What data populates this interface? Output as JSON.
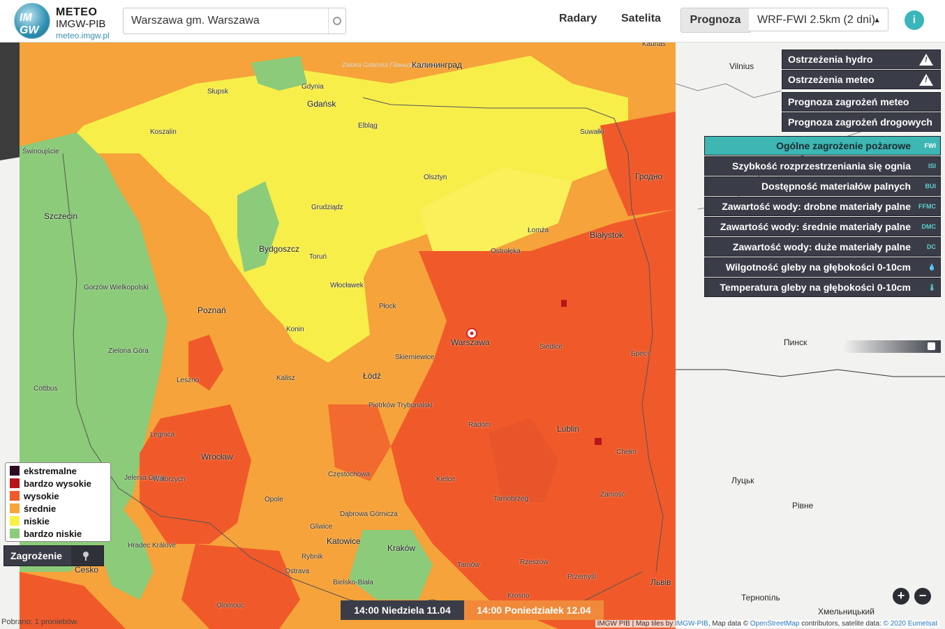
{
  "header": {
    "logo_line1": "METEO",
    "logo_line2": "IMGW-PIB",
    "logo_url": "meteo.imgw.pl",
    "logo_badge": "IM GW",
    "search_value": "Warszawa gm. Warszawa",
    "nav": {
      "radar": "Radary",
      "satellite": "Satelita"
    },
    "prognoza": "Prognoza",
    "model_select": "WRF-FWI 2.5km (2 dni)",
    "info_glyph": "i"
  },
  "right_panel": {
    "warnings": [
      {
        "label": "Ostrzeżenia hydro",
        "icon": "warning-icon"
      },
      {
        "label": "Ostrzeżenia meteo",
        "icon": "warning-icon"
      },
      {
        "label": "Prognoza zagrożeń meteo"
      },
      {
        "label": "Prognoza zagrożeń drogowych"
      }
    ],
    "layers": [
      {
        "label": "Ogólne zagrożenie pożarowe",
        "abbr": "FWI",
        "active": true
      },
      {
        "label": "Szybkość rozprzestrzeniania się ognia",
        "abbr": "ISI"
      },
      {
        "label": "Dostępność materiałów palnych",
        "abbr": "BUI"
      },
      {
        "label": "Zawartość wody: drobne materiały palne",
        "abbr": "FFMC"
      },
      {
        "label": "Zawartość wody: średnie materiały palne",
        "abbr": "DMC"
      },
      {
        "label": "Zawartość wody: duże materiały palne",
        "abbr": "DC"
      },
      {
        "label": "Wilgotność gleby na głębokości 0-10cm",
        "abbr": "💧"
      },
      {
        "label": "Temperatura gleby na głębokości 0-10cm",
        "abbr": "🌡"
      }
    ]
  },
  "legend": {
    "items": [
      {
        "label": "ekstremalne",
        "color": "#2b0a22"
      },
      {
        "label": "bardzo wysokie",
        "color": "#b8141c"
      },
      {
        "label": "wysokie",
        "color": "#f05a2a"
      },
      {
        "label": "średnie",
        "color": "#f7a53a"
      },
      {
        "label": "niskie",
        "color": "#f7f049"
      },
      {
        "label": "bardzo niskie",
        "color": "#8ccb7a"
      }
    ],
    "toggle_label": "Zagrożenie"
  },
  "timebar": {
    "current": "14:00 Niedziela 11.04",
    "next": "14:00 Poniedziałek 12.04"
  },
  "zoom": {
    "in": "+",
    "out": "−"
  },
  "status": "Pobrano: 1 proniebów.",
  "attribution": {
    "prefix": "IMGW PIB | Map tiles by ",
    "imgw": "IMGW-PIB",
    "mid": ", Map data © ",
    "osm": "OpenStreetMap",
    "mid2": " contributors, satelite data: ",
    "eum": "© 2020 Eumetsat"
  },
  "map": {
    "sea_label": "Zatoka Gdańska Гданьская бухта",
    "selected_city": "Warszawa",
    "cities": [
      "Gdańsk",
      "Gdynia",
      "Słupsk",
      "Koszalin",
      "Świnoujście",
      "Szczecin",
      "Elbląg",
      "Kaliningrad",
      "Калининград",
      "Olsztyn",
      "Grudziądz",
      "Bydgoszcz",
      "Toruń",
      "Włocławek",
      "Płock",
      "Gorzów Wielkopolski",
      "Poznań",
      "Konin",
      "Zielona Góra",
      "Cottbus",
      "Leszno",
      "Kalisz",
      "Łódź",
      "Skierniewice",
      "Piotrków Trybunalski",
      "Legnica",
      "Wrocław",
      "Jelenia Góra",
      "Wałbrzych",
      "Opole",
      "Częstochowa",
      "Kielce",
      "Radom",
      "Lublin",
      "Chełm",
      "Zamość",
      "Tarnobrzeg",
      "Dąbrowa Górnicza",
      "Gliwice",
      "Katowice",
      "Rybnik",
      "Kraków",
      "Ostrava",
      "Bielsko-Biała",
      "Tarnów",
      "Rzeszów",
      "Przemyśl",
      "Krosno",
      "Olomouc",
      "Hradec Králové",
      "Česko",
      "Siedlce",
      "Ostrołęka",
      "Łomża",
      "Białystok",
      "Suwałki",
      "Kaunas",
      "Vilnius",
      "Гродно",
      "Брест",
      "Пинск",
      "Луцьк",
      "Рівне",
      "Львів",
      "Тернопіль",
      "Хмельницький"
    ],
    "city_warszawa": "Warszawa",
    "city_gdansk": "Gdańsk",
    "city_kaunas": "Kaunas",
    "city_vilnius": "Vilnius",
    "city_kaliningrad": "Калининград",
    "city_olsztyn": "Olsztyn",
    "city_bydgoszcz": "Bydgoszcz",
    "city_poznan": "Poznań",
    "city_szczecin": "Szczecin",
    "city_lodz": "Łódź",
    "city_wroclaw": "Wrocław",
    "city_krakow": "Kraków",
    "city_lublin": "Lublin",
    "city_bialystok": "Białystok",
    "city_grodno": "Гродно",
    "city_brest": "Брест",
    "city_pinsk": "Пинск",
    "city_lutsk": "Луцьк",
    "city_rivne": "Рівне",
    "city_lviv": "Львів",
    "city_ternopil": "Тернопіль",
    "city_khm": "Хмельницький",
    "city_koszalin": "Koszalin",
    "city_slupsk": "Słupsk",
    "city_gdynia": "Gdynia",
    "city_elblag": "Elbląg",
    "city_swin": "Świnoujście",
    "city_grudziadz": "Grudziądz",
    "city_torun": "Toruń",
    "city_wloclawek": "Włocławek",
    "city_plock": "Płock",
    "city_gorzow": "Gorzów Wielkopolski",
    "city_konin": "Konin",
    "city_zielona": "Zielona Góra",
    "city_cottbus": "Cottbus",
    "city_leszno": "Leszno",
    "city_kalisz": "Kalisz",
    "city_skier": "Skierniewice",
    "city_piotrkow": "Piotrków Trybunalski",
    "city_legnica": "Legnica",
    "city_jelenia": "Jelenia Góra",
    "city_walbrzych": "Wałbrzych",
    "city_opole": "Opole",
    "city_czest": "Częstochowa",
    "city_kielce": "Kielce",
    "city_radom": "Radom",
    "city_chelm": "Chełm",
    "city_zamosc": "Zamość",
    "city_tarnobrzeg": "Tarnobrzeg",
    "city_dabrowa": "Dąbrowa Górnicza",
    "city_gliwice": "Gliwice",
    "city_katowice": "Katowice",
    "city_rybnik": "Rybnik",
    "city_ostrava": "Ostrava",
    "city_bielsko": "Bielsko-Biała",
    "city_tarnow": "Tarnów",
    "city_rzeszow": "Rzeszów",
    "city_przemysl": "Przemyśl",
    "city_krosno": "Krosno",
    "city_olomouc": "Olomouc",
    "city_hradec": "Hradec Králové",
    "city_cesko": "Cesko",
    "city_siedlce": "Siedlce",
    "city_ostroleka": "Ostrołęka",
    "city_lomza": "Łomża",
    "city_suwalki": "Suwałki"
  }
}
